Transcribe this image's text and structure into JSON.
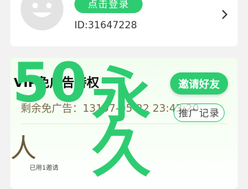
{
  "profile": {
    "login_label": "点击登录",
    "user_id": "ID:31647228"
  },
  "vip": {
    "title": "VIP免广告特权",
    "invite_label": "邀请好友",
    "remaining_label": "剩余免广告：",
    "remaining_value": "13197-05-22 23:43:20",
    "record_label": "推广记录",
    "people_char": "人",
    "hint_text": "已用1邀请"
  },
  "overlay": {
    "fifty": "50",
    "yong": "永",
    "jiu": "久"
  },
  "colors": {
    "accent": "#2ecc71"
  }
}
